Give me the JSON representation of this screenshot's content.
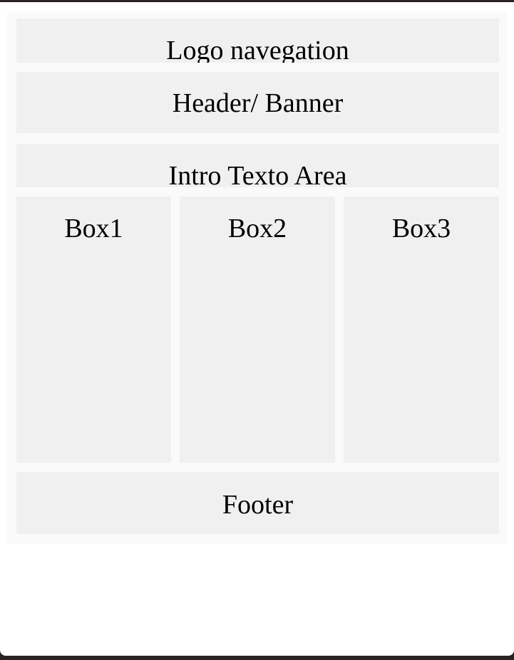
{
  "layout": {
    "logo_nav": "Logo navegation",
    "header_banner": "Header/ Banner",
    "intro": "Intro Texto Area",
    "boxes": [
      {
        "label": "Box1"
      },
      {
        "label": "Box2"
      },
      {
        "label": "Box3"
      }
    ],
    "footer": "Footer"
  },
  "colors": {
    "block_bg": "#f0f0f0",
    "wrapper_bg": "#fafafa",
    "page_bg": "#ffffff",
    "frame_bg": "#2a2224"
  }
}
